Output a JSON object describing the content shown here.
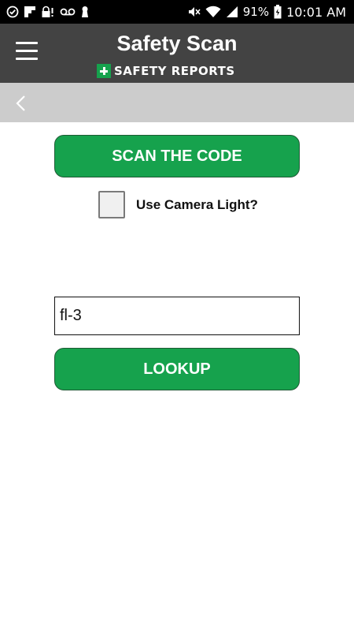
{
  "status_bar": {
    "battery_percent": "91%",
    "time": "10:01 AM",
    "left_icons": [
      "check-circle-icon",
      "flipboard-icon",
      "lock-alert-icon",
      "voicemail-icon",
      "keyhole-icon"
    ],
    "right_icons": [
      "mute-icon",
      "wifi-icon",
      "signal-icon",
      "battery-icon"
    ]
  },
  "header": {
    "title": "Safety Scan",
    "brand_text": "SAFETY REPORTS",
    "menu_icon": "hamburger-menu-icon",
    "brand_color": "#16a24d",
    "background_color": "#434343"
  },
  "nav": {
    "back_icon": "chevron-left-icon"
  },
  "scan": {
    "button_label": "SCAN THE CODE",
    "camera_light_label": "Use Camera Light?",
    "camera_light_checked": false
  },
  "lookup": {
    "input_value": "fl-3",
    "button_label": "LOOKUP"
  },
  "colors": {
    "accent_green": "#16a24d",
    "nav_gray": "#cccccc"
  }
}
